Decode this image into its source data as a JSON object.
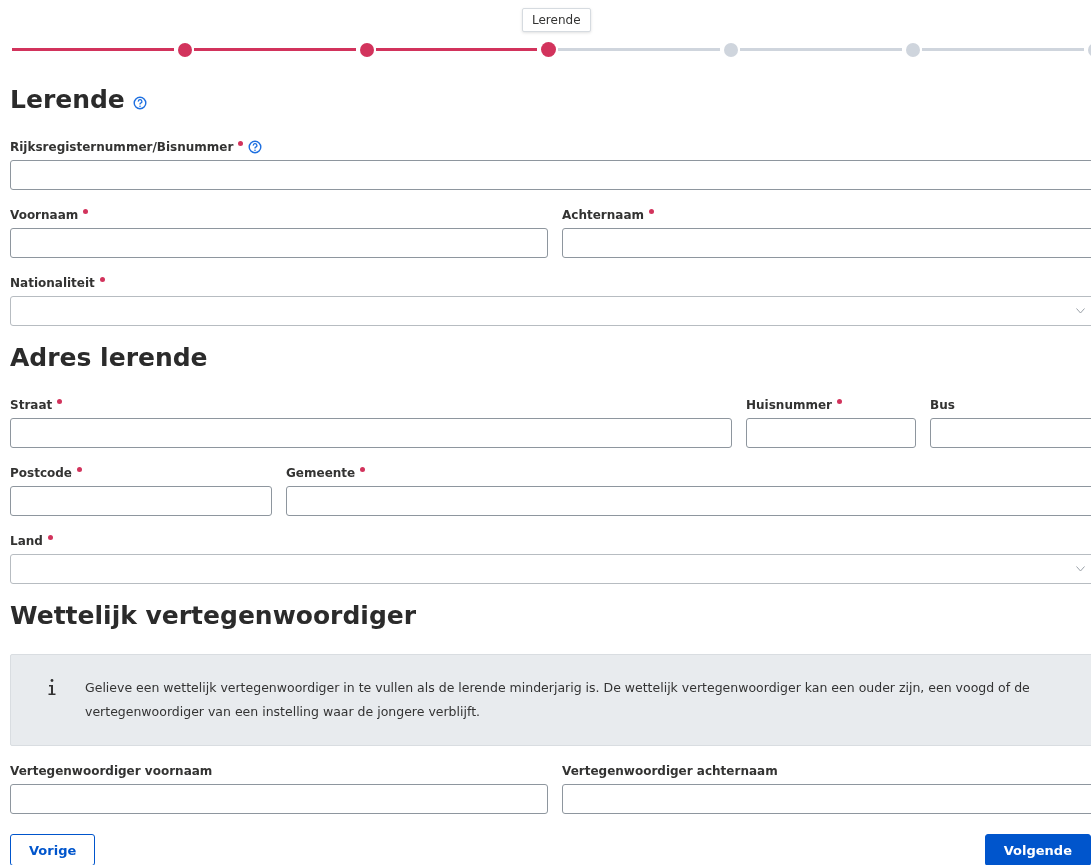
{
  "stepper": {
    "tooltip": "Lerende",
    "steps": [
      {
        "done": true,
        "selected": false
      },
      {
        "done": true,
        "selected": false
      },
      {
        "done": false,
        "selected": true
      },
      {
        "done": false,
        "selected": false
      },
      {
        "done": false,
        "selected": false
      },
      {
        "done": false,
        "selected": false
      }
    ]
  },
  "sections": [
    {
      "title": "Lerende",
      "help": true,
      "rows": [
        [
          {
            "label": "Rijksregisternummer/Bisnummer",
            "required": true,
            "help": true,
            "kind": "text"
          }
        ],
        [
          {
            "label": "Voornaam",
            "required": true,
            "help": false,
            "kind": "text"
          },
          {
            "label": "Achternaam",
            "required": true,
            "help": false,
            "kind": "text"
          }
        ],
        [
          {
            "label": "Nationaliteit",
            "required": true,
            "help": false,
            "kind": "select"
          }
        ]
      ]
    },
    {
      "title": "Adres lerende",
      "help": false,
      "rows": [
        [
          {
            "label": "Straat",
            "required": true,
            "help": false,
            "kind": "text"
          },
          {
            "label": "Huisnummer",
            "required": true,
            "help": false,
            "kind": "text"
          },
          {
            "label": "Bus",
            "required": false,
            "help": false,
            "kind": "text"
          }
        ],
        [
          {
            "label": "Postcode",
            "required": true,
            "help": false,
            "kind": "text"
          },
          {
            "label": "Gemeente",
            "required": true,
            "help": false,
            "kind": "text"
          }
        ],
        [
          {
            "label": "Land",
            "required": true,
            "help": false,
            "kind": "select"
          }
        ]
      ]
    },
    {
      "title": "Wettelijk vertegenwoordiger",
      "help": false,
      "info": "Gelieve een wettelijk vertegenwoordiger in te vullen als de lerende minderjarig is. De wettelijk vertegenwoordiger kan een ouder zijn, een voogd of de vertegenwoordiger van een instelling waar de jongere verblijft.",
      "rows": [
        [
          {
            "label": "Vertegenwoordiger voornaam",
            "required": false,
            "help": false,
            "kind": "text"
          },
          {
            "label": "Vertegenwoordiger achternaam",
            "required": false,
            "help": false,
            "kind": "text"
          }
        ]
      ]
    }
  ],
  "buttons": [
    {
      "label": "Vorige",
      "kind": "secondary"
    },
    {
      "label": "Volgende",
      "kind": "primary"
    }
  ]
}
